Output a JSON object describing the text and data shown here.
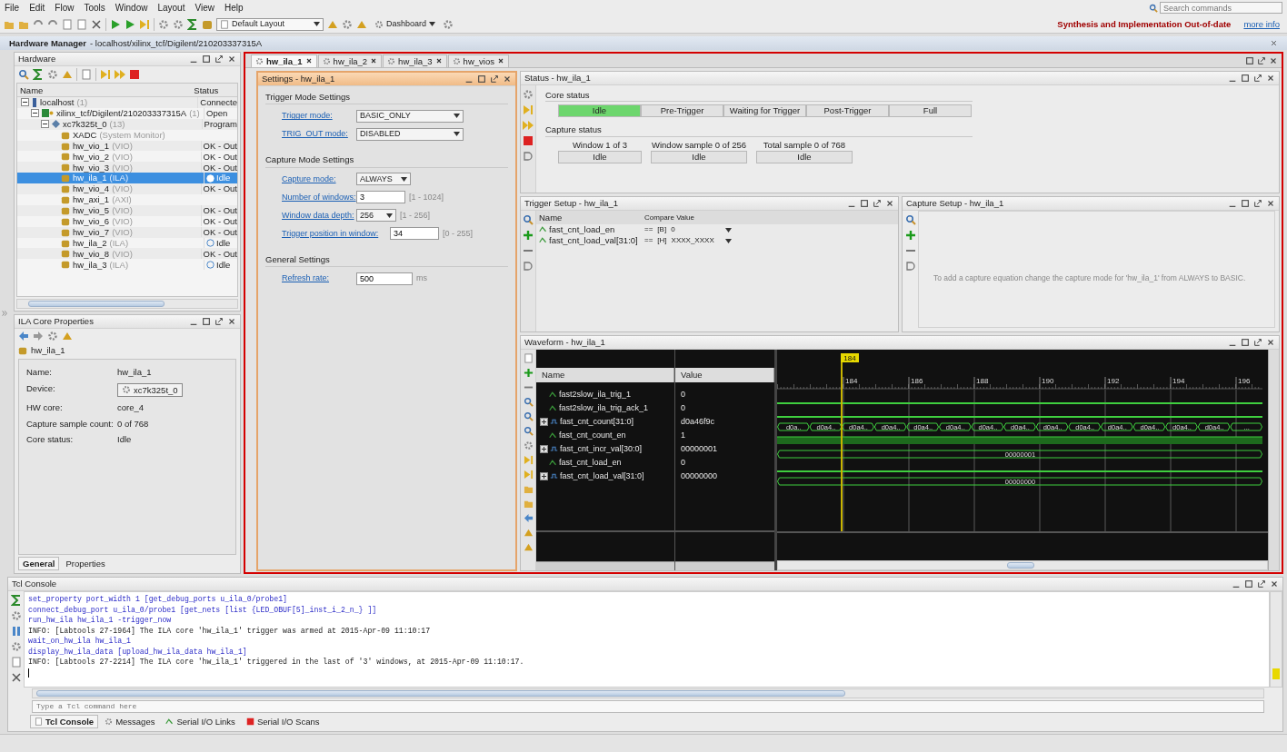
{
  "menu": [
    "File",
    "Edit",
    "Flow",
    "Tools",
    "Window",
    "Layout",
    "View",
    "Help"
  ],
  "search": {
    "placeholder": "Search commands"
  },
  "toolbar": {
    "layout": "Default Layout",
    "dashboard": "Dashboard"
  },
  "banner": {
    "message": "Synthesis and Implementation Out-of-date",
    "link": "more info"
  },
  "manager": {
    "title": "Hardware Manager",
    "path": "- localhost/xilinx_tcf/Digilent/210203337315A"
  },
  "hardware": {
    "title": "Hardware",
    "columns": [
      "Name",
      "Status"
    ],
    "tree": [
      {
        "kind": "host",
        "name": "localhost",
        "tag": "(1)",
        "status": "Connecte",
        "selected": false,
        "expanded": true,
        "children": [
          {
            "kind": "target",
            "name": "xilinx_tcf/Digilent/210203337315A",
            "tag": "(1)",
            "status": "Open",
            "selected": false,
            "expanded": true,
            "children": [
              {
                "kind": "device",
                "name": "xc7k325t_0",
                "tag": "(13)",
                "status": "Program",
                "selected": false,
                "expanded": true,
                "children": [
                  {
                    "kind": "core",
                    "name": "XADC",
                    "tag": "(System Monitor)",
                    "selected": false
                  },
                  {
                    "kind": "core",
                    "name": "hw_vio_1",
                    "tag": "(VIO)",
                    "status": "OK - Out",
                    "selected": false
                  },
                  {
                    "kind": "core",
                    "name": "hw_vio_2",
                    "tag": "(VIO)",
                    "status": "OK - Out",
                    "selected": false
                  },
                  {
                    "kind": "core",
                    "name": "hw_vio_3",
                    "tag": "(VIO)",
                    "status": "OK - Out",
                    "selected": false
                  },
                  {
                    "kind": "ila",
                    "name": "hw_ila_1",
                    "tag": "(ILA)",
                    "status": "Idle",
                    "selected": true
                  },
                  {
                    "kind": "core",
                    "name": "hw_vio_4",
                    "tag": "(VIO)",
                    "status": "OK - Out",
                    "selected": false
                  },
                  {
                    "kind": "core",
                    "name": "hw_axi_1",
                    "tag": "(AXI)",
                    "selected": false
                  },
                  {
                    "kind": "core",
                    "name": "hw_vio_5",
                    "tag": "(VIO)",
                    "status": "OK - Out",
                    "selected": false
                  },
                  {
                    "kind": "core",
                    "name": "hw_vio_6",
                    "tag": "(VIO)",
                    "status": "OK - Out",
                    "selected": false
                  },
                  {
                    "kind": "core",
                    "name": "hw_vio_7",
                    "tag": "(VIO)",
                    "status": "OK - Out",
                    "selected": false
                  },
                  {
                    "kind": "ila",
                    "name": "hw_ila_2",
                    "tag": "(ILA)",
                    "status": "Idle",
                    "selected": false
                  },
                  {
                    "kind": "core",
                    "name": "hw_vio_8",
                    "tag": "(VIO)",
                    "status": "OK - Out",
                    "selected": false
                  },
                  {
                    "kind": "ila",
                    "name": "hw_ila_3",
                    "tag": "(ILA)",
                    "status": "Idle",
                    "selected": false
                  }
                ]
              }
            ]
          }
        ]
      }
    ]
  },
  "ila_properties": {
    "title": "ILA Core Properties",
    "object": "hw_ila_1",
    "fields": [
      {
        "label": "Name:",
        "value": "hw_ila_1",
        "kind": "text"
      },
      {
        "label": "Device:",
        "value": "xc7k325t_0",
        "kind": "device"
      },
      {
        "label": "HW core:",
        "value": "core_4",
        "kind": "text"
      },
      {
        "label": "Capture sample count:",
        "value": "0 of 768",
        "kind": "text"
      },
      {
        "label": "Core status:",
        "value": "Idle",
        "kind": "text"
      }
    ],
    "tabs": [
      {
        "label": "General",
        "selected": true
      },
      {
        "label": "Properties",
        "selected": false
      }
    ]
  },
  "tabs": [
    {
      "label": "hw_ila_1",
      "selected": true
    },
    {
      "label": "hw_ila_2",
      "selected": false
    },
    {
      "label": "hw_ila_3",
      "selected": false
    },
    {
      "label": "hw_vios",
      "selected": false
    }
  ],
  "settings": {
    "title": "Settings - hw_ila_1",
    "sections": [
      {
        "title": "Trigger Mode Settings",
        "rows": [
          {
            "label": "Trigger mode:",
            "kind": "select",
            "value": "BASIC_ONLY"
          },
          {
            "label": "TRIG_OUT mode:",
            "kind": "select",
            "value": "DISABLED"
          }
        ]
      },
      {
        "title": "Capture Mode Settings",
        "rows": [
          {
            "label": "Capture mode:",
            "kind": "select",
            "value": "ALWAYS"
          },
          {
            "label": "Number of windows:",
            "kind": "input",
            "value": "3",
            "hint": "[1 - 1024]"
          },
          {
            "label": "Window data depth:",
            "kind": "select",
            "value": "256",
            "hint": "[1 - 256]"
          },
          {
            "label": "Trigger position in window:",
            "kind": "input",
            "value": "34",
            "hint": "[0 - 255]"
          }
        ]
      },
      {
        "title": "General Settings",
        "rows": [
          {
            "label": "Refresh rate:",
            "kind": "input",
            "value": "500",
            "unit": "ms"
          }
        ]
      }
    ]
  },
  "status": {
    "title": "Status - hw_ila_1",
    "core_heading": "Core status",
    "stages": [
      {
        "label": "Idle",
        "selected": true
      },
      {
        "label": "Pre-Trigger",
        "selected": false
      },
      {
        "label": "Waiting for Trigger",
        "selected": false
      },
      {
        "label": "Post-Trigger",
        "selected": false
      },
      {
        "label": "Full",
        "selected": false
      }
    ],
    "capture_heading": "Capture status",
    "capture": [
      {
        "label": "Window 1 of 3",
        "value": "Idle"
      },
      {
        "label": "Window sample 0 of 256",
        "value": "Idle"
      },
      {
        "label": "Total sample 0 of 768",
        "value": "Idle"
      }
    ]
  },
  "trigger_setup": {
    "title": "Trigger Setup - hw_ila_1",
    "columns": [
      "Name",
      "Compare Value"
    ],
    "rows": [
      {
        "name": "fast_cnt_load_en",
        "operator": "==",
        "radix": "[B]",
        "value": "0"
      },
      {
        "name": "fast_cnt_load_val[31:0]",
        "operator": "==",
        "radix": "[H]",
        "value": "XXXX_XXXX"
      }
    ]
  },
  "capture_setup": {
    "title": "Capture Setup - hw_ila_1",
    "message": "To add a capture equation change the capture mode for 'hw_ila_1' from ALWAYS to BASIC."
  },
  "waveform": {
    "title": "Waveform - hw_ila_1",
    "columns": [
      "Name",
      "Value"
    ],
    "cursor": "184",
    "ticks": [
      "184",
      "186",
      "188",
      "190",
      "192",
      "194",
      "196"
    ],
    "signals": [
      {
        "kind": "bit",
        "name": "fast2slow_ila_trig_1",
        "value": "0",
        "high": false
      },
      {
        "kind": "bit",
        "name": "fast2slow_ila_trig_ack_1",
        "value": "0",
        "high": false
      },
      {
        "kind": "bus",
        "name": "fast_cnt_count[31:0]",
        "value": "d0a46f9c",
        "expanded": false,
        "segments": [
          "d0a..",
          "d0a4..",
          "d0a4..",
          "d0a4..",
          "d0a4..",
          "d0a4..",
          "d0a4..",
          "d0a4..",
          "d0a4..",
          "d0a4..",
          "d0a4..",
          "d0a4..",
          "d0a4..",
          "d0a4..",
          "..."
        ]
      },
      {
        "kind": "bit",
        "name": "fast_cnt_count_en",
        "value": "1",
        "high": true
      },
      {
        "kind": "bus",
        "name": "fast_cnt_incr_val[30:0]",
        "value": "00000001",
        "expanded": false,
        "segments": [
          "00000001"
        ]
      },
      {
        "kind": "bit",
        "name": "fast_cnt_load_en",
        "value": "0",
        "high": false
      },
      {
        "kind": "bus",
        "name": "fast_cnt_load_val[31:0]",
        "value": "00000000",
        "expanded": false,
        "segments": [
          "00000000"
        ]
      }
    ]
  },
  "tcl": {
    "title": "Tcl Console",
    "lines": [
      {
        "kind": "command",
        "text": "set_property port_width 1 [get_debug_ports u_ila_0/probe1]"
      },
      {
        "kind": "command",
        "text": "connect_debug_port u_ila_0/probe1 [get_nets [list {LED_OBUF[5]_inst_i_2_n_} ]]"
      },
      {
        "kind": "command",
        "text": "run_hw_ila hw_ila_1 -trigger_now"
      },
      {
        "kind": "info",
        "text": "INFO: [Labtools 27-1964] The ILA core 'hw_ila_1' trigger was armed at 2015-Apr-09 11:10:17"
      },
      {
        "kind": "command",
        "text": "wait_on_hw_ila hw_ila_1"
      },
      {
        "kind": "command",
        "text": "display_hw_ila_data [upload_hw_ila_data hw_ila_1]"
      },
      {
        "kind": "info",
        "text": "INFO: [Labtools 27-2214] The ILA core 'hw_ila_1' triggered in the last of '3' windows, at 2015-Apr-09 11:10:17."
      }
    ],
    "placeholder": "Type a Tcl command here",
    "tabs": [
      {
        "label": "Tcl Console",
        "selected": true
      },
      {
        "label": "Messages",
        "selected": false
      },
      {
        "label": "Serial I/O Links",
        "selected": false
      },
      {
        "label": "Serial I/O Scans",
        "selected": false
      }
    ]
  }
}
